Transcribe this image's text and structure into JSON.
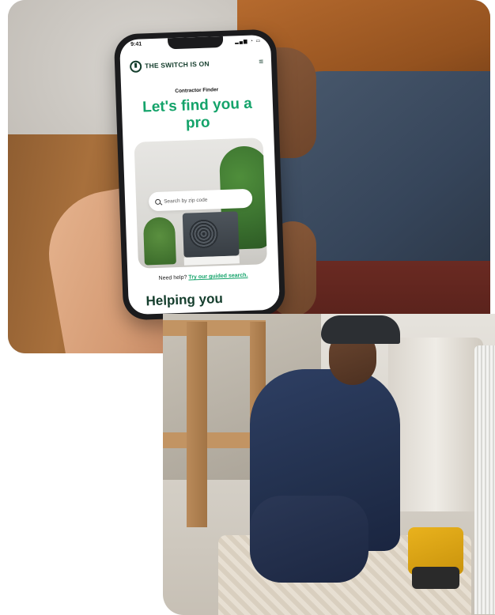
{
  "phone": {
    "status_time": "9:41",
    "status_icons": "▂▄▆ ◔ ▭",
    "logo_text": "THE SWITCH IS ON",
    "menu_icon": "≡",
    "kicker": "Contractor Finder",
    "headline": "Let's find you a pro",
    "search_placeholder": "Search by zip code",
    "help_text": "Need help?",
    "help_link": "Try our guided search.",
    "section_heading": "Helping you"
  },
  "colors": {
    "brand_green": "#14a36a",
    "brand_dark": "#143d2c"
  },
  "icons": [
    "logo-plug-icon",
    "menu-icon",
    "search-icon"
  ]
}
